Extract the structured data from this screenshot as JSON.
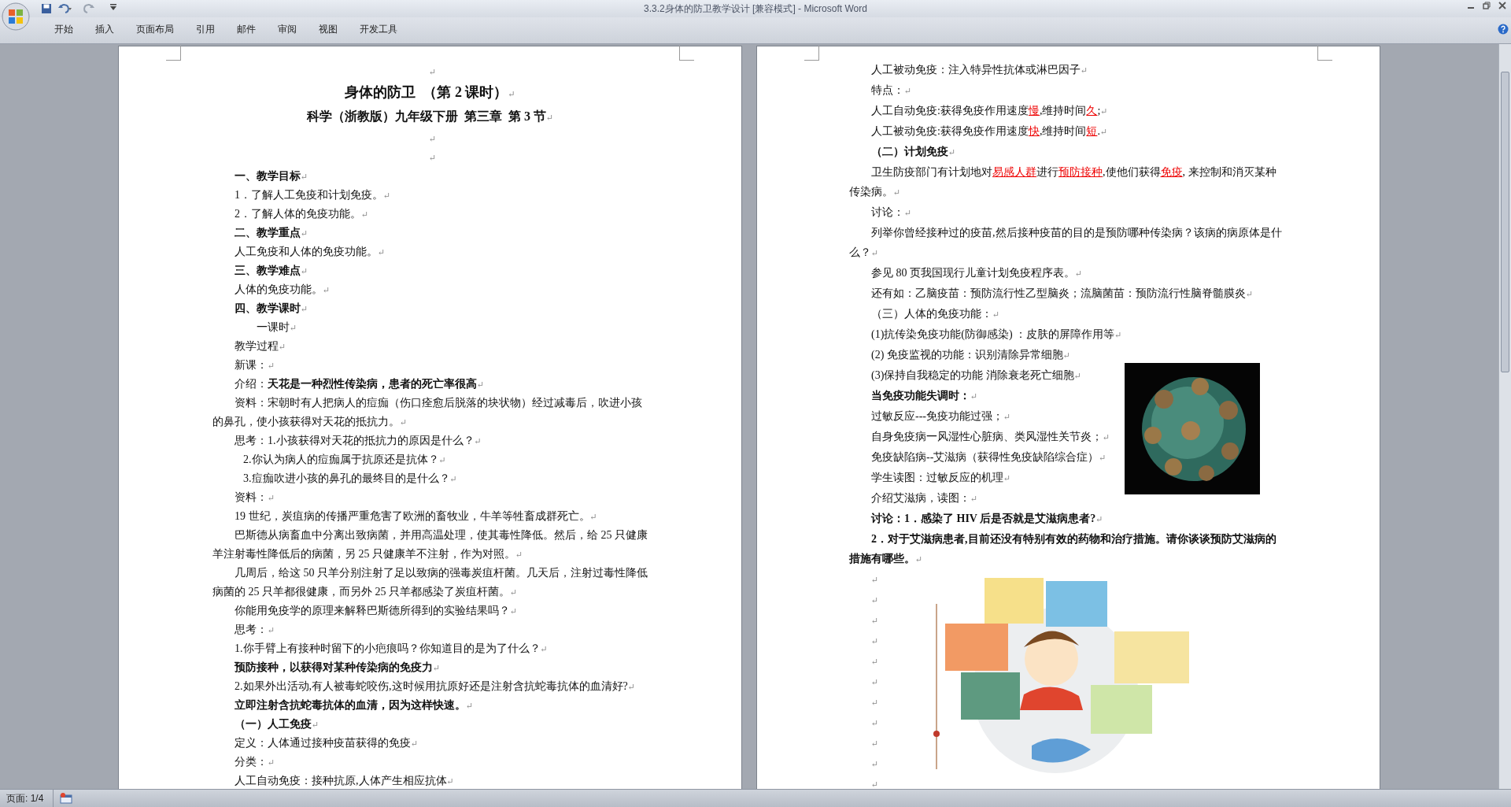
{
  "window": {
    "title": "3.3.2身体的防卫教学设计 [兼容模式] - Microsoft Word"
  },
  "ribbon": {
    "tabs": [
      {
        "label": "开始",
        "selected": false
      },
      {
        "label": "插入",
        "selected": false
      },
      {
        "label": "页面布局",
        "selected": false
      },
      {
        "label": "引用",
        "selected": false
      },
      {
        "label": "邮件",
        "selected": false
      },
      {
        "label": "审阅",
        "selected": false
      },
      {
        "label": "视图",
        "selected": false
      },
      {
        "label": "开发工具",
        "selected": false
      }
    ]
  },
  "pages": [
    {
      "paragraphs": [
        {
          "kind": "mark",
          "mark": "↵"
        },
        {
          "kind": "title",
          "text": "身体的防卫  （第 2 课时）",
          "mark": "↵"
        },
        {
          "kind": "subtitle",
          "text": "科学（浙教版）九年级下册  第三章  第 3 节",
          "mark": "↵"
        },
        {
          "kind": "mark",
          "mark": "↵"
        },
        {
          "kind": "mark",
          "mark": "↵"
        },
        {
          "kind": "strong",
          "text": "一、教学目标",
          "mark": "↵"
        },
        {
          "kind": "text",
          "text": "1．了解人工免疫和计划免疫。",
          "mark": "↵"
        },
        {
          "kind": "text",
          "text": "2．了解人体的免疫功能。",
          "mark": "↵"
        },
        {
          "kind": "strong",
          "text": "二、教学重点",
          "mark": "↵"
        },
        {
          "kind": "text",
          "text": "人工免疫和人体的免疫功能。",
          "mark": "↵"
        },
        {
          "kind": "strong",
          "text": "三、教学难点",
          "mark": "↵"
        },
        {
          "kind": "text",
          "text": "人体的免疫功能。",
          "mark": "↵"
        },
        {
          "kind": "strong",
          "text": "四、教学课时",
          "mark": "↵"
        },
        {
          "kind": "indent",
          "text": "一课时",
          "mark": "↵"
        },
        {
          "kind": "text",
          "text": "教学过程",
          "mark": "↵"
        },
        {
          "kind": "text",
          "text": "新课：",
          "mark": "↵"
        },
        {
          "kind": "text",
          "text": "介绍：**天花是一种烈性传染病，患者的死亡率很高**",
          "mark": "↵"
        },
        {
          "kind": "text",
          "text": "资料：宋朝时有人把病人的痘痂（伤口痊愈后脱落的块状物）经过减毒后，吹进小孩的鼻孔，使小孩获得对天花的抵抗力。",
          "mark": "↵"
        },
        {
          "kind": "text",
          "text": "思考：1.小孩获得对天花的抵抗力的原因是什么？",
          "mark": "↵"
        },
        {
          "kind": "sub",
          "text": "2.你认为病人的痘痂属于抗原还是抗体？",
          "mark": "↵"
        },
        {
          "kind": "sub",
          "text": "3.痘痂吹进小孩的鼻孔的最终目的是什么？",
          "mark": "↵"
        },
        {
          "kind": "text",
          "text": "资料：",
          "mark": "↵"
        },
        {
          "kind": "text",
          "text": "19 世纪，炭疽病的传播严重危害了欧洲的畜牧业，牛羊等牲畜成群死亡。",
          "mark": "↵"
        },
        {
          "kind": "text",
          "text": "巴斯德从病畜血中分离出致病菌，并用高温处理，使其毒性降低。然后，给 25 只健康羊注射毒性降低后的病菌，另 25 只健康羊不注射，作为对照。",
          "mark": "↵"
        },
        {
          "kind": "text",
          "text": "几周后，给这 50 只羊分别注射了足以致病的强毒炭疽杆菌。几天后，注射过毒性降低病菌的 25 只羊都很健康，而另外 25 只羊都感染了炭疽杆菌。",
          "mark": "↵"
        },
        {
          "kind": "text",
          "text": "你能用免疫学的原理来解释巴斯德所得到的实验结果吗？",
          "mark": "↵"
        },
        {
          "kind": "text",
          "text": "思考：",
          "mark": "↵"
        },
        {
          "kind": "text",
          "text": "1.你手臂上有接种时留下的小疤痕吗？你知道目的是为了什么？",
          "mark": "↵"
        },
        {
          "kind": "strong",
          "text": "预防接种，以获得对某种传染病的免疫力",
          "mark": "↵"
        },
        {
          "kind": "text",
          "text": "2.如果外出活动,有人被毒蛇咬伤,这时候用抗原好还是注射含抗蛇毒抗体的血清好?",
          "mark": "↵"
        },
        {
          "kind": "strong",
          "text": "立即注射含抗蛇毒抗体的血清，因为这样快速。",
          "mark": "↵"
        },
        {
          "kind": "strong",
          "text": "（一）人工免疫",
          "mark": "↵"
        },
        {
          "kind": "text",
          "text": "定义：人体通过接种疫苗获得的免疫",
          "mark": "↵"
        },
        {
          "kind": "text",
          "text": "分类：",
          "mark": "↵"
        },
        {
          "kind": "text",
          "text": "人工自动免疫：接种抗原,人体产生相应抗体",
          "mark": "↵"
        }
      ]
    },
    {
      "paragraphs": [
        {
          "kind": "text",
          "text": "人工被动免疫：注入特异性抗体或淋巴因子",
          "mark": "↵"
        },
        {
          "kind": "text",
          "text": "特点：",
          "mark": "↵"
        },
        {
          "kind": "text",
          "parts": [
            {
              "text": "人工自动免疫:获得免疫作用速度",
              "marked": false
            },
            {
              "text": "慢",
              "marked": true
            },
            {
              "text": ",维持时间",
              "marked": false
            },
            {
              "text": "久",
              "marked": true
            },
            {
              "text": ";",
              "marked": false
            }
          ],
          "mark": "↵"
        },
        {
          "kind": "text",
          "parts": [
            {
              "text": "人工被动免疫:获得免疫作用速度",
              "marked": false
            },
            {
              "text": "快",
              "marked": true
            },
            {
              "text": ",维持时间",
              "marked": false
            },
            {
              "text": "短",
              "marked": true
            },
            {
              "text": ".",
              "marked": false
            }
          ],
          "mark": "↵"
        },
        {
          "kind": "strong",
          "text": "（二）计划免疫",
          "mark": "↵"
        },
        {
          "kind": "text",
          "parts": [
            {
              "text": "卫生防疫部门有计划地对",
              "marked": false
            },
            {
              "text": "易感人群",
              "marked": true
            },
            {
              "text": "进行",
              "marked": false
            },
            {
              "text": "预防接种",
              "marked": true
            },
            {
              "text": ",使他们获得",
              "marked": false
            },
            {
              "text": "免疫",
              "marked": true
            },
            {
              "text": ", 来控制和消灭某种传染病。",
              "marked": false
            }
          ],
          "mark": "↵"
        },
        {
          "kind": "text",
          "text": "讨论：",
          "mark": "↵"
        },
        {
          "kind": "text",
          "text": "列举你曾经接种过的疫苗,然后接种疫苗的目的是预防哪种传染病？该病的病原体是什么？",
          "mark": "↵"
        },
        {
          "kind": "text",
          "text": "参见 80 页我国现行儿童计划免疫程序表。",
          "mark": "↵"
        },
        {
          "kind": "text",
          "text": "还有如：乙脑疫苗：预防流行性乙型脑炎；流脑菌苗：预防流行性脑脊髓膜炎",
          "mark": "↵"
        },
        {
          "kind": "text",
          "text": "（三）人体的免疫功能：",
          "mark": "↵"
        },
        {
          "kind": "text",
          "text": "(1)抗传染免疫功能(防御感染) ：皮肤的屏障作用等",
          "mark": "↵"
        },
        {
          "kind": "text",
          "text": "(2) 免疫监视的功能：识别清除异常细胞",
          "mark": "↵"
        },
        {
          "kind": "text",
          "text": "(3)保持自我稳定的功能 消除衰老死亡细胞",
          "mark": "↵"
        },
        {
          "kind": "strong",
          "text": "当免疫功能失调时：",
          "mark": "↵"
        },
        {
          "kind": "text",
          "text": "过敏反应---免疫功能过强；",
          "mark": "↵"
        },
        {
          "kind": "text",
          "text": "自身免疫病一风湿性心脏病、类风湿性关节炎；",
          "mark": "↵"
        },
        {
          "kind": "text",
          "text": "免疫缺陷病--艾滋病（获得性免疫缺陷综合症）",
          "mark": "↵"
        },
        {
          "kind": "text",
          "text": "学生读图：过敏反应的机理",
          "mark": "↵"
        },
        {
          "kind": "text",
          "text": "介绍艾滋病，读图：",
          "mark": "↵"
        },
        {
          "kind": "strong",
          "text": "讨论：1．感染了 HIV 后是否就是艾滋病患者?",
          "mark": "↵"
        },
        {
          "kind": "strong",
          "text": "2．对于艾滋病患者,目前还没有特别有效的药物和治疗措施。请你谈谈预防艾滋病的措施有哪些。",
          "mark": "↵"
        },
        {
          "kind": "blank",
          "mark": "↵"
        },
        {
          "kind": "blank",
          "mark": "↵"
        },
        {
          "kind": "blank",
          "mark": "↵"
        },
        {
          "kind": "blank",
          "mark": "↵"
        },
        {
          "kind": "blank",
          "mark": "↵"
        },
        {
          "kind": "blank",
          "mark": "↵"
        },
        {
          "kind": "blank",
          "mark": "↵"
        },
        {
          "kind": "blank",
          "mark": "↵"
        },
        {
          "kind": "blank",
          "mark": "↵"
        },
        {
          "kind": "blank",
          "mark": "↵"
        },
        {
          "kind": "blank",
          "mark": "↵"
        }
      ]
    }
  ],
  "status_bar": {
    "page": "页面: 1/4"
  }
}
